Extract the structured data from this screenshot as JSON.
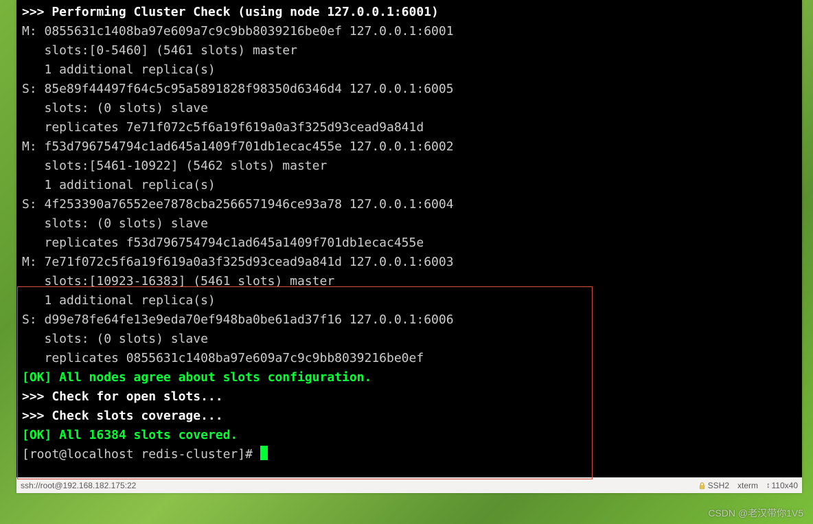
{
  "terminal": {
    "lines": [
      {
        "cls": "bold",
        "text": ">>> Performing Cluster Check (using node 127.0.0.1:6001)"
      },
      {
        "cls": "",
        "text": "M: 0855631c1408ba97e609a7c9c9bb8039216be0ef 127.0.0.1:6001"
      },
      {
        "cls": "",
        "text": "   slots:[0-5460] (5461 slots) master"
      },
      {
        "cls": "",
        "text": "   1 additional replica(s)"
      },
      {
        "cls": "",
        "text": "S: 85e89f44497f64c5c95a5891828f98350d6346d4 127.0.0.1:6005"
      },
      {
        "cls": "",
        "text": "   slots: (0 slots) slave"
      },
      {
        "cls": "",
        "text": "   replicates 7e71f072c5f6a19f619a0a3f325d93cead9a841d"
      },
      {
        "cls": "",
        "text": "M: f53d796754794c1ad645a1409f701db1ecac455e 127.0.0.1:6002"
      },
      {
        "cls": "",
        "text": "   slots:[5461-10922] (5462 slots) master"
      },
      {
        "cls": "",
        "text": "   1 additional replica(s)"
      },
      {
        "cls": "",
        "text": "S: 4f253390a76552ee7878cba2566571946ce93a78 127.0.0.1:6004"
      },
      {
        "cls": "",
        "text": "   slots: (0 slots) slave"
      },
      {
        "cls": "",
        "text": "   replicates f53d796754794c1ad645a1409f701db1ecac455e"
      },
      {
        "cls": "",
        "text": "M: 7e71f072c5f6a19f619a0a3f325d93cead9a841d 127.0.0.1:6003"
      },
      {
        "cls": "",
        "text": "   slots:[10923-16383] (5461 slots) master"
      },
      {
        "cls": "",
        "text": "   1 additional replica(s)"
      },
      {
        "cls": "",
        "text": "S: d99e78fe64fe13e9eda70ef948ba0be61ad37f16 127.0.0.1:6006"
      },
      {
        "cls": "",
        "text": "   slots: (0 slots) slave"
      },
      {
        "cls": "",
        "text": "   replicates 0855631c1408ba97e609a7c9c9bb8039216be0ef"
      },
      {
        "cls": "green-bold",
        "text": "[OK] All nodes agree about slots configuration."
      },
      {
        "cls": "bold",
        "text": ">>> Check for open slots..."
      },
      {
        "cls": "bold",
        "text": ">>> Check slots coverage..."
      },
      {
        "cls": "green-bold",
        "text": "[OK] All 16384 slots covered."
      }
    ],
    "prompt": "[root@localhost redis-cluster]# "
  },
  "statusbar": {
    "left": "ssh://root@192.168.182.175:22",
    "ssh": "SSH2",
    "term": "xterm",
    "size": "110x40"
  },
  "watermark": "CSDN @老汉带你1V5"
}
